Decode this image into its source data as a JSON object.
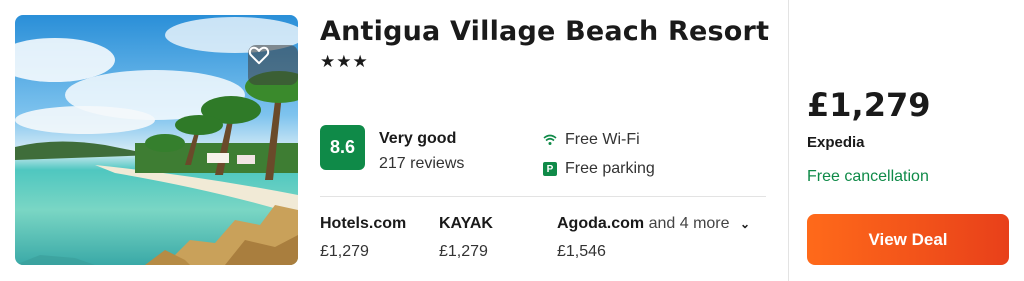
{
  "hotel": {
    "name": "Antigua Village Beach Resort",
    "stars": "★★★",
    "favorite_icon": "heart-outline-icon"
  },
  "rating": {
    "score": "8.6",
    "label": "Very good",
    "reviews": "217 reviews",
    "badge_color": "#0f8a48"
  },
  "amenities": [
    {
      "icon": "wifi-icon",
      "label": "Free Wi-Fi"
    },
    {
      "icon": "parking-icon",
      "label": "Free parking"
    }
  ],
  "providers": [
    {
      "name": "Hotels.com",
      "price": "£1,279"
    },
    {
      "name": "KAYAK",
      "price": "£1,279"
    },
    {
      "name": "Agoda.com",
      "price": "£1,546"
    }
  ],
  "more_providers": "and 4 more",
  "deal": {
    "price": "£1,279",
    "provider": "Expedia",
    "cancellation": "Free cancellation",
    "button_label": "View Deal",
    "button_color": "#f05a1a"
  }
}
